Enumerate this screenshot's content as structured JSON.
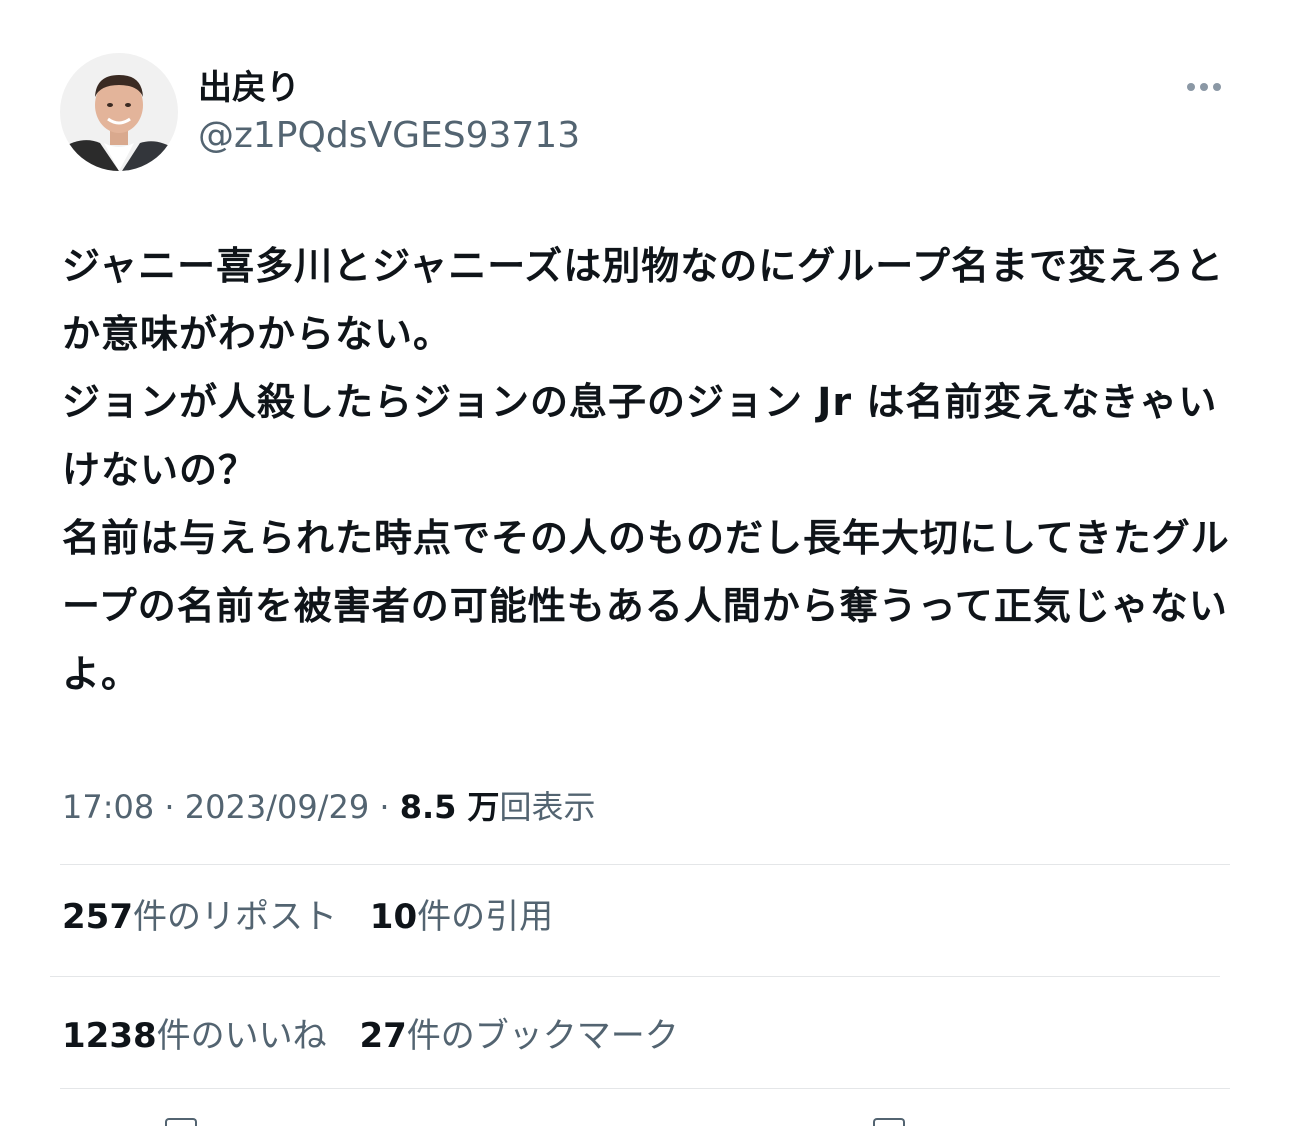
{
  "tweet": {
    "author": {
      "display_name": "出戻り",
      "handle": "@z1PQdsVGES93713",
      "avatar_icon": "user-avatar-photo"
    },
    "more_icon": "more-horizontal-icon",
    "text": "ジャニー喜多川とジャニーズは別物なのにグループ名まで変えろとか意味がわからない。\nジョンが人殺したらジョンの息子のジョン Jr は名前変えなきゃいけないの？\n名前は与えられた時点でその人のものだし長年大切にしてきたグループの名前を被害者の可能性もある人間から奪うって正気じゃないよ。",
    "time": "17:08",
    "date": "2023/09/29",
    "separator": " · ",
    "views_count": "8.5 万",
    "views_label": "回表示",
    "stats": {
      "reposts": {
        "count": "257",
        "label": "件のリポスト"
      },
      "quotes": {
        "count": "10",
        "label": "件の引用"
      },
      "likes": {
        "count": "1238",
        "label": "件のいいね"
      },
      "bookmarks": {
        "count": "27",
        "label": "件のブックマーク"
      }
    }
  },
  "colors": {
    "text_primary": "#0f1419",
    "text_secondary": "#536471",
    "divider": "#e4e6e8"
  }
}
